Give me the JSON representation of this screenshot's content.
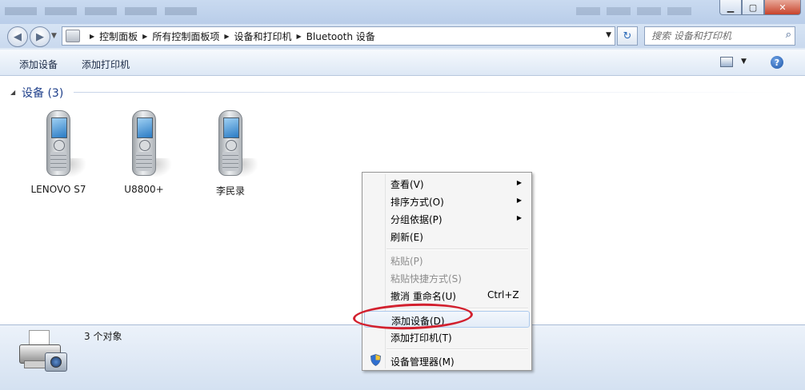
{
  "window": {
    "minimize_icon": "minimize-icon",
    "maximize_icon": "maximize-icon",
    "close_icon": "close-icon"
  },
  "address_bar": {
    "breadcrumbs": [
      "控制面板",
      "所有控制面板项",
      "设备和打印机",
      "Bluetooth 设备"
    ],
    "search_placeholder": "搜索 设备和打印机"
  },
  "command_bar": {
    "add_device": "添加设备",
    "add_printer": "添加打印机",
    "help_glyph": "?"
  },
  "group": {
    "title": "设备 (3)"
  },
  "devices": [
    {
      "label": "LENOVO S7",
      "icon": "phone-icon"
    },
    {
      "label": "U8800+",
      "icon": "phone-icon"
    },
    {
      "label": "李民录",
      "icon": "phone-icon"
    }
  ],
  "details": {
    "count_text": "3 个对象"
  },
  "context_menu": {
    "items": [
      {
        "label": "查看(V)",
        "submenu": true,
        "enabled": true
      },
      {
        "label": "排序方式(O)",
        "submenu": true,
        "enabled": true
      },
      {
        "label": "分组依据(P)",
        "submenu": true,
        "enabled": true
      },
      {
        "label": "刷新(E)",
        "submenu": false,
        "enabled": true
      },
      {
        "label": "粘贴(P)",
        "submenu": false,
        "enabled": false
      },
      {
        "label": "粘贴快捷方式(S)",
        "submenu": false,
        "enabled": false
      },
      {
        "label": "撤消 重命名(U)",
        "shortcut": "Ctrl+Z",
        "submenu": false,
        "enabled": true
      },
      {
        "label": "添加设备(D)",
        "submenu": false,
        "enabled": true,
        "highlighted": true
      },
      {
        "label": "添加打印机(T)",
        "submenu": false,
        "enabled": true
      },
      {
        "label": "设备管理器(M)",
        "submenu": false,
        "enabled": true,
        "icon": "uac-shield-icon"
      }
    ]
  },
  "annotation": {
    "color": "#d2202e"
  }
}
